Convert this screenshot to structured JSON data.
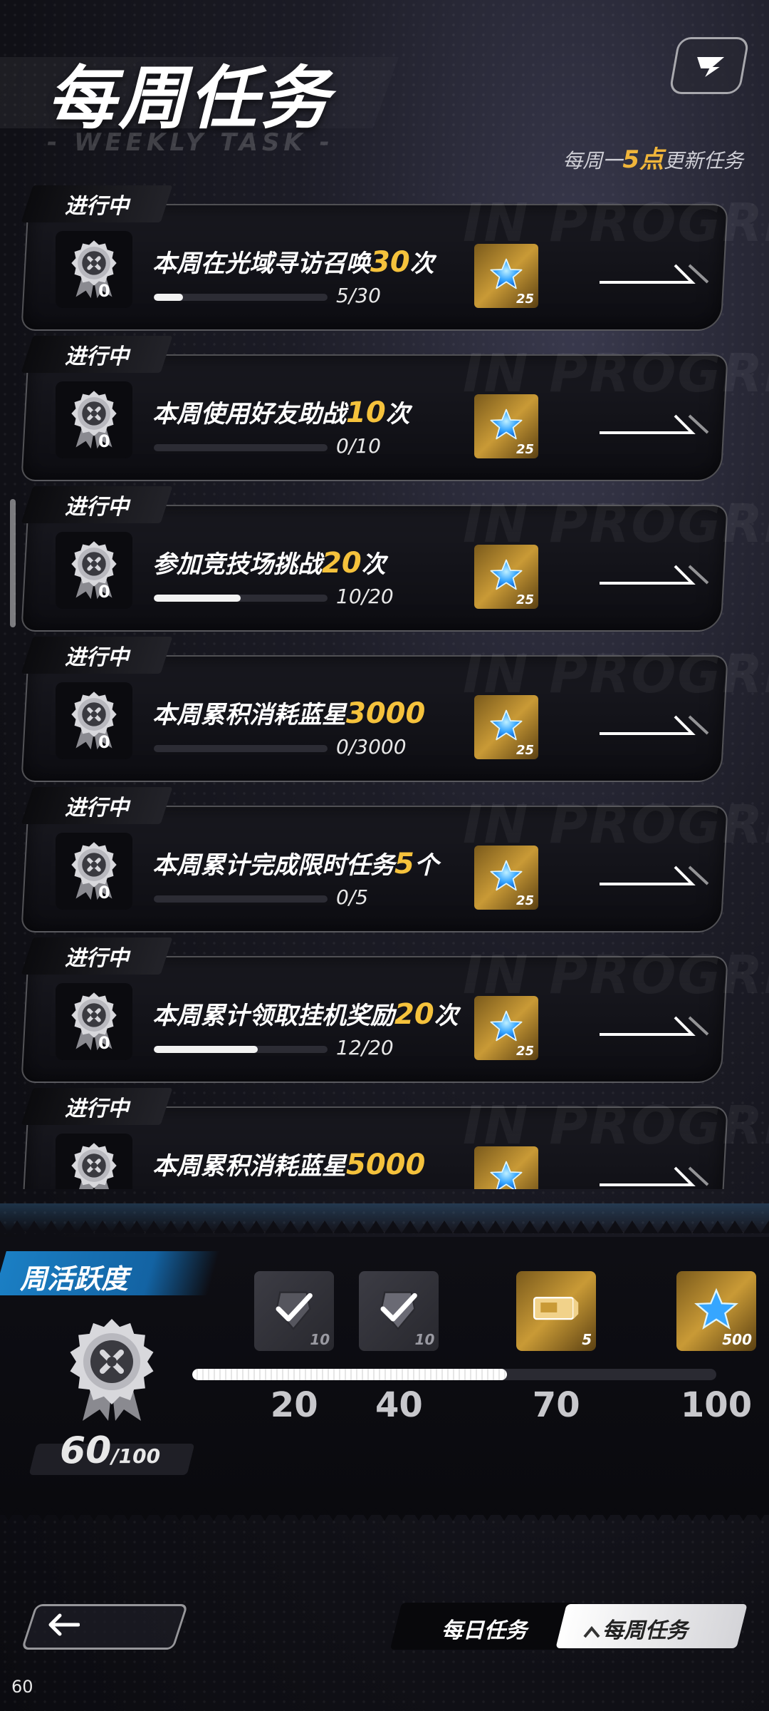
{
  "header": {
    "title": "每周任务",
    "subtitle_deco": "- WEEKLY TASK -",
    "refresh_prefix": "每周一",
    "refresh_highlight": "5点",
    "refresh_suffix": "更新任务"
  },
  "card_deco_text": "IN PROGRESS",
  "tasks": [
    {
      "status": "进行中",
      "medal_count": "0",
      "name_prefix": "本周在光域寻访召唤",
      "target": "30",
      "name_suffix": "次",
      "progress": 0.1667,
      "progress_text": "5/30",
      "reward_qty": "25"
    },
    {
      "status": "进行中",
      "medal_count": "0",
      "name_prefix": "本周使用好友助战",
      "target": "10",
      "name_suffix": "次",
      "progress": 0.0,
      "progress_text": "0/10",
      "reward_qty": "25"
    },
    {
      "status": "进行中",
      "medal_count": "0",
      "name_prefix": "参加竞技场挑战",
      "target": "20",
      "name_suffix": "次",
      "progress": 0.5,
      "progress_text": "10/20",
      "reward_qty": "25"
    },
    {
      "status": "进行中",
      "medal_count": "0",
      "name_prefix": "本周累积消耗蓝星",
      "target": "3000",
      "name_suffix": "",
      "progress": 0.0,
      "progress_text": "0/3000",
      "reward_qty": "25"
    },
    {
      "status": "进行中",
      "medal_count": "0",
      "name_prefix": "本周累计完成限时任务",
      "target": "5",
      "name_suffix": "个",
      "progress": 0.0,
      "progress_text": "0/5",
      "reward_qty": "25"
    },
    {
      "status": "进行中",
      "medal_count": "0",
      "name_prefix": "本周累计领取挂机奖励",
      "target": "20",
      "name_suffix": "次",
      "progress": 0.6,
      "progress_text": "12/20",
      "reward_qty": "25"
    },
    {
      "status": "进行中",
      "medal_count": "",
      "name_prefix": "本周累积消耗蓝星",
      "target": "5000",
      "name_suffix": "",
      "progress": 0.0,
      "progress_text": "",
      "reward_qty": ""
    }
  ],
  "activity": {
    "title": "周活跃度",
    "current": "60",
    "max": "/100",
    "progress": 0.6,
    "milestones": [
      {
        "label": "20",
        "qty": "10",
        "icon": "armor-check-icon",
        "claimed": true,
        "value": 20
      },
      {
        "label": "40",
        "qty": "10",
        "icon": "helmet-check-icon",
        "claimed": true,
        "value": 40
      },
      {
        "label": "70",
        "qty": "5",
        "icon": "ticket-icon",
        "claimed": false,
        "value": 70
      },
      {
        "label": "100",
        "qty": "500",
        "icon": "blue-star-icon",
        "claimed": false,
        "value": 100
      }
    ]
  },
  "nav": {
    "daily_tab": "每日任务",
    "weekly_tab": "每周任务"
  },
  "fps": "60",
  "colors": {
    "accent_gold": "#f5c23c",
    "activity_blue": "#1b7fc4",
    "star_blue": "#36a6ff"
  }
}
